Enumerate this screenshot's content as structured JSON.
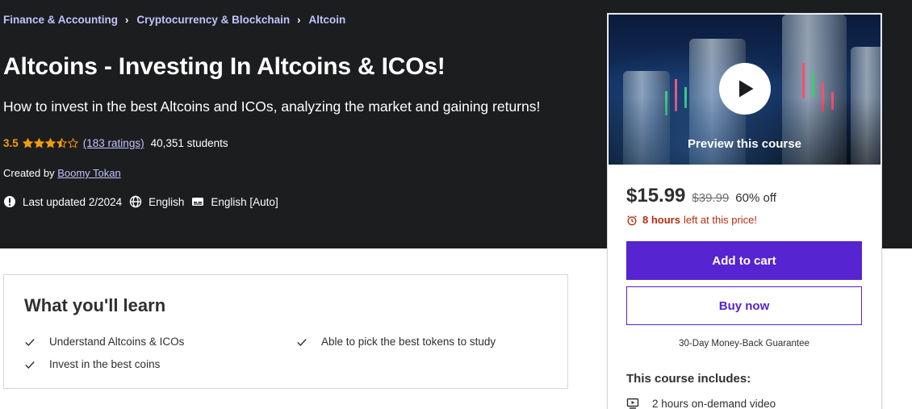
{
  "breadcrumb": [
    {
      "label": "Finance & Accounting"
    },
    {
      "label": "Cryptocurrency & Blockchain"
    },
    {
      "label": "Altcoin"
    }
  ],
  "course": {
    "title": "Altcoins - Investing In Altcoins & ICOs!",
    "subtitle": "How to invest in the best Altcoins and ICOs, analyzing the market and gaining returns!",
    "rating": "3.5",
    "rating_stars": 3.5,
    "ratings_count": "(183 ratings)",
    "students": "40,351 students",
    "created_by_label": "Created by",
    "instructor": "Boomy Tokan",
    "last_updated": "Last updated 2/2024",
    "language": "English",
    "captions": "English [Auto]"
  },
  "sidebar": {
    "preview_label": "Preview this course",
    "price": "$15.99",
    "original_price": "$39.99",
    "discount": "60% off",
    "timer_bold": "8 hours",
    "timer_rest": "left at this price!",
    "add_to_cart": "Add to cart",
    "buy_now": "Buy now",
    "guarantee": "30-Day Money-Back Guarantee",
    "includes_title": "This course includes:",
    "includes": [
      {
        "icon": "video-icon",
        "label": "2 hours on-demand video"
      }
    ]
  },
  "learn": {
    "title": "What you'll learn",
    "items": [
      {
        "label": "Understand Altcoins & ICOs"
      },
      {
        "label": "Able to pick the best tokens to study"
      },
      {
        "label": "Invest in the best coins"
      }
    ]
  },
  "colors": {
    "hero_bg": "#1c1d1f",
    "accent_purple": "#5624d0",
    "link_lavender": "#c0c4fc",
    "rating_orange": "#f69c08",
    "timer_red": "#b32d0f"
  }
}
